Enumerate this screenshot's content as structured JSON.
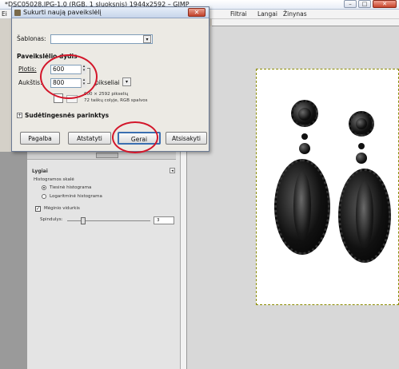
{
  "main_window": {
    "title": "*DSC05028.JPG-1.0 (RGB, 1 sluoksnis) 1944x2592 – GIMP",
    "controls": {
      "minimize": "–",
      "maximize": "□",
      "close": "✕"
    }
  },
  "menubar": {
    "items": [
      "Ei",
      "Filtrai",
      "Langai",
      "Žinynas"
    ]
  },
  "dialog": {
    "title": "Sukurti naują paveikslėlį",
    "close": "✕",
    "template_label": "Šablonas:",
    "template_value": "",
    "size_section_label": "Paveikslėlio dydis",
    "width_label": "Plotis:",
    "width_value": "600",
    "height_label": "Aukštis:",
    "height_value": "800",
    "units_value": "pikseliai",
    "info_line1": "600 × 2592 pikselių",
    "info_line2": "72 taškų colyje, RGB spalvos",
    "advanced_label": "Sudėtingesnės parinktys",
    "buttons": {
      "help": "Pagalba",
      "reset": "Atstatyti",
      "ok": "Gerai",
      "cancel": "Atsisakyti"
    }
  },
  "dock": {
    "title": "Lygiai",
    "histogram_scale_label": "Histogramos skalė",
    "linear_label": "Tiesinė histograma",
    "log_label": "Logaritminė histograma",
    "average_label": "Mėginio vidurkis",
    "radius_label": "Spindulys:",
    "radius_value": "3"
  },
  "colors": {
    "annotation_ring": "#d3162a",
    "dialog_title_bg": "#c7d5ea",
    "canvas_border": "#8a8a00"
  }
}
